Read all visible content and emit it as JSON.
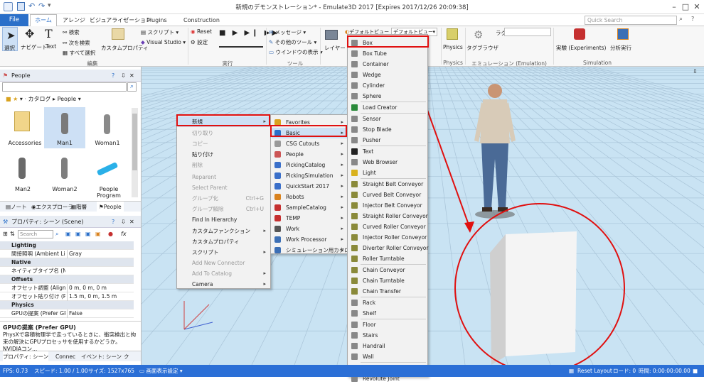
{
  "titlebar": {
    "title": "新規のデモンストレーション* - Emulate3D 2017 [Expires 2017/12/26 20:09:38]"
  },
  "tabs": {
    "file": "File",
    "home": "ホーム",
    "arrange": "アレンジ",
    "visual": "ビジュアライゼーション",
    "plugins": "Plugins",
    "construction": "Construction"
  },
  "search": {
    "placeholder": "Quick Search"
  },
  "ribbon": {
    "select": "選択",
    "navigate": "ナビゲート",
    "text": "Text",
    "search": "検索",
    "search_next": "次を検索",
    "select_all": "すべて選択",
    "custom_props": "カスタムプロパティ",
    "script": "スクリプト",
    "visual_studio": "Visual Studio",
    "group_edit": "編集",
    "reset": "Reset",
    "settings": "設定",
    "group_run": "実行",
    "message": "メッセージ",
    "other_tools": "その他のツール",
    "window_display": "ウインドウの表示",
    "group_tools": "ツール",
    "layer": "レイヤー",
    "default_view": "デフォルトビュー",
    "default_view_sel": "デフォルトビュー",
    "physics": "Physics",
    "group_physics": "Physics",
    "tag_browser": "タグブラウザ",
    "lag_label": "ラグ",
    "group_emulation": "エミュレーション (Emulation)",
    "experiments": "実験 (Experiments)",
    "analysis": "分析実行",
    "group_simulation": "Simulation"
  },
  "people_panel": {
    "title": "People",
    "catalog": "カタログ",
    "people": "People",
    "items": [
      {
        "label": "Accessories"
      },
      {
        "label": "Man1"
      },
      {
        "label": "Woman1"
      },
      {
        "label": "Man2"
      },
      {
        "label": "Woman2"
      },
      {
        "label": "People Program"
      }
    ],
    "tabs": [
      "ノート",
      "エクスプローラ",
      "階層",
      "People"
    ]
  },
  "props_panel": {
    "title": "プロパティ: シーン (Scene)",
    "search": "Search",
    "rows": [
      {
        "type": "cat",
        "name": "Lighting"
      },
      {
        "type": "row",
        "name": "間接照明 (Ambient Lig",
        "value": "Gray"
      },
      {
        "type": "cat",
        "name": "Native"
      },
      {
        "type": "row",
        "name": "ネイティブタイプ名 (Nati",
        "value": ""
      },
      {
        "type": "cat",
        "name": "Offsets"
      },
      {
        "type": "row",
        "name": "オフセット調整 (Align O",
        "value": "0 m, 0 m, 0 m"
      },
      {
        "type": "row",
        "name": "オフセット貼り付け (Past",
        "value": "1.5 m, 0 m, 1.5 m"
      },
      {
        "type": "cat",
        "name": "Physics"
      },
      {
        "type": "row",
        "name": "GPUの提案 (Prefer GP",
        "value": "False"
      }
    ],
    "desc_title": "GPUの提案 (Prefer GPU)",
    "desc_text": "PhysXで容積物理学で走っているときに、衝突検出と拘束の解決にGPUプロセッサを使用するかどうか。NVIDIAコン...",
    "tabs": [
      "プロパティ: シーン",
      "Connec",
      "イベント: シーン",
      "ク"
    ]
  },
  "ctx_menu": {
    "items": [
      {
        "label": "新規",
        "sub": true,
        "dis": false
      },
      {
        "label": "切り取り",
        "dis": true
      },
      {
        "label": "コピー",
        "dis": true
      },
      {
        "label": "貼り付け",
        "dis": false
      },
      {
        "label": "削除",
        "dis": true
      },
      {
        "label": "Reparent",
        "dis": true
      },
      {
        "label": "Select Parent",
        "dis": true
      },
      {
        "label": "グループ化",
        "dis": true,
        "sc": "Ctrl+G"
      },
      {
        "label": "グループ解除",
        "dis": true,
        "sc": "Ctrl+U"
      },
      {
        "label": "Find In Hierarchy",
        "dis": false
      },
      {
        "label": "カスタムファンクション",
        "sub": true,
        "dis": false
      },
      {
        "label": "カスタムプロパティ",
        "dis": false
      },
      {
        "label": "スクリプト",
        "sub": true,
        "dis": false
      },
      {
        "label": "Add New Connector",
        "dis": true
      },
      {
        "label": "Add To Catalog",
        "sub": true,
        "dis": true
      },
      {
        "label": "Camera",
        "sub": true,
        "dis": false
      }
    ]
  },
  "sub_menu": {
    "items": [
      "Favorites",
      "Basic",
      "CSG Cutouts",
      "People",
      "PickingCatalog",
      "PickingSimulation",
      "QuickStart 2017",
      "Robots",
      "SampleCatalog",
      "TEMP",
      "Work",
      "Work Processor",
      "シミュレーション用カタログ"
    ]
  },
  "basic_menu": {
    "items": [
      "Box",
      "Box Tube",
      "Container",
      "Wedge",
      "Cylinder",
      "Sphere",
      "Load Creator",
      "Sensor",
      "Stop Blade",
      "Pusher",
      "Text",
      "Web Browser",
      "Light",
      "Straight Belt Conveyor",
      "Curved Belt Conveyor",
      "Injector Belt Conveyor",
      "Straight Roller Conveyor",
      "Curved Roller Conveyor",
      "Injector Roller Conveyor",
      "Diverter Roller Conveyor",
      "Roller Turntable",
      "Chain Conveyor",
      "Chain Turntable",
      "Chain Transfer",
      "Rack",
      "Shelf",
      "Floor",
      "Stairs",
      "Handrail",
      "Wall",
      "Prismatic Joint",
      "Revolute Joint"
    ]
  },
  "status": {
    "fps": "FPS: 0.73",
    "speed": "スピード: 1.00 / 1.00",
    "size": "サイズ: 1527x765",
    "display": "画面表示設定",
    "reset_layout": "Reset Layout",
    "load": "ロード: 0",
    "time": "時間: 0:00:00:00.00"
  },
  "colors": {
    "accent": "#2a6fc9",
    "highlight": "#e01010",
    "status": "#2b6fd6"
  }
}
